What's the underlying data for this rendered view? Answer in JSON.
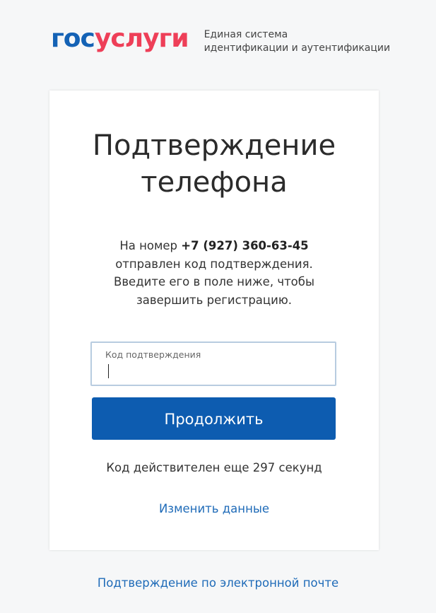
{
  "header": {
    "logo_part1": "гос",
    "logo_part2": "услуги",
    "tagline_line1": "Единая система",
    "tagline_line2": "идентификации и аутентификации"
  },
  "card": {
    "title_line1": "Подтверждение",
    "title_line2": "телефона",
    "desc_prefix": "На номер ",
    "phone": "+7 (927) 360-63-45",
    "desc_line2": "отправлен код подтверждения.",
    "desc_line3": "Введите его в поле ниже, чтобы",
    "desc_line4": "завершить регистрацию.",
    "code_field_label": "Код подтверждения",
    "code_field_value": "",
    "continue_label": "Продолжить",
    "timer_text": "Код действителен еще 297 секунд",
    "change_link": "Изменить данные"
  },
  "footer": {
    "email_link": "Подтверждение по электронной почте"
  },
  "colors": {
    "logo_blue": "#1462b5",
    "logo_red": "#ee3f58",
    "button": "#0d5cb0",
    "link": "#1f6bb8"
  }
}
